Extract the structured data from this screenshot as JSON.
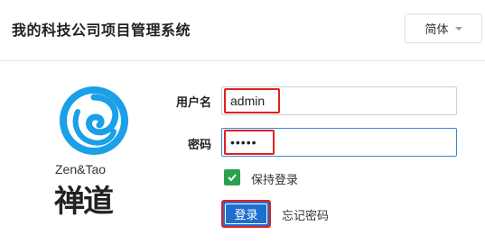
{
  "header": {
    "title": "我的科技公司项目管理系统",
    "language_button": "简体"
  },
  "logo": {
    "brand_text": "Zen&Tao",
    "chinese_text": "禅道"
  },
  "form": {
    "username_label": "用户名",
    "username_value": "admin",
    "password_label": "密码",
    "password_masked": "•••••",
    "keep_login_label": "保持登录",
    "keep_login_checked": true,
    "login_button": "登录",
    "forgot_password_link": "忘记密码"
  },
  "colors": {
    "accent": "#1f6fd0",
    "checkbox": "#2aa14e",
    "highlight_border": "#e02020",
    "logo_blue": "#1aa0e8"
  }
}
